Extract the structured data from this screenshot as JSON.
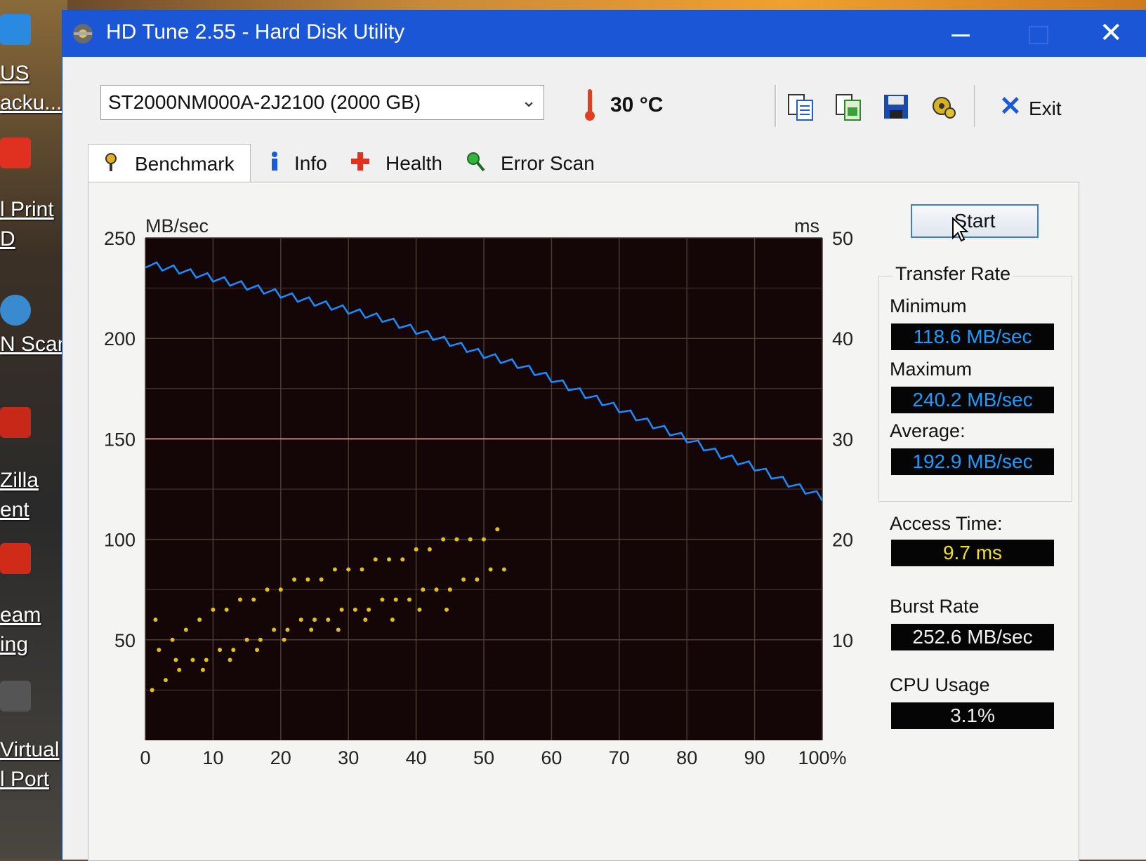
{
  "desktop": {
    "labels": [
      "US",
      "acku...",
      "l Print",
      "D",
      "N Scan",
      "Zilla",
      "ent",
      "eam",
      "ing",
      "Virtual",
      "l Port"
    ]
  },
  "window": {
    "title": "HD Tune 2.55 - Hard Disk Utility",
    "minimize_glyph": "—",
    "close_glyph": "✕"
  },
  "toolbar": {
    "drive": "ST2000NM000A-2J2100 (2000 GB)",
    "dropdown_glyph": "⌄",
    "temperature": "30 °C",
    "buttons": [
      "copy-text-icon",
      "copy-image-icon",
      "save-icon",
      "options-icon"
    ],
    "exit_label": "Exit"
  },
  "tabs": [
    {
      "label": "Benchmark",
      "icon": "benchmark-icon",
      "active": true
    },
    {
      "label": "Info",
      "icon": "info-icon",
      "active": false
    },
    {
      "label": "Health",
      "icon": "health-icon",
      "active": false
    },
    {
      "label": "Error Scan",
      "icon": "error-scan-icon",
      "active": false
    }
  ],
  "side_panel": {
    "start_label": "Start",
    "transfer_rate_title": "Transfer Rate",
    "minimum_label": "Minimum",
    "minimum_value": "118.6 MB/sec",
    "maximum_label": "Maximum",
    "maximum_value": "240.2 MB/sec",
    "average_label": "Average:",
    "average_value": "192.9 MB/sec",
    "access_time_label": "Access Time:",
    "access_time_value": "9.7 ms",
    "burst_rate_label": "Burst Rate",
    "burst_rate_value": "252.6 MB/sec",
    "cpu_usage_label": "CPU Usage",
    "cpu_usage_value": "3.1%"
  },
  "chart_data": {
    "type": "line",
    "title": "",
    "xlabel": "",
    "ylabel": "MB/sec",
    "y2label": "ms",
    "x_ticks": [
      "0",
      "10",
      "20",
      "30",
      "40",
      "50",
      "60",
      "70",
      "80",
      "90",
      "100%"
    ],
    "y_ticks": [
      "250",
      "200",
      "150",
      "100",
      "50"
    ],
    "y2_ticks": [
      "50",
      "40",
      "30",
      "20",
      "10"
    ],
    "xlim": [
      0,
      100
    ],
    "ylim": [
      0,
      250
    ],
    "y2lim": [
      0,
      50
    ],
    "grid": true,
    "colors": {
      "transfer": "#1a8cff",
      "access": "#e0c020",
      "background": "#140606",
      "grid": "#4a3a36",
      "midline": "#c08080"
    },
    "series": [
      {
        "axis": "left",
        "x": [
          0,
          5,
          10,
          15,
          20,
          25,
          30,
          35,
          40,
          45,
          50,
          55,
          60,
          65,
          70,
          75,
          80,
          85,
          90,
          95,
          100
        ],
        "values": [
          237,
          234,
          230,
          226,
          222,
          218,
          214,
          210,
          204,
          198,
          192,
          187,
          180,
          172,
          165,
          157,
          150,
          142,
          136,
          128,
          121
        ]
      },
      {
        "type": "scatter",
        "axis": "right",
        "x": [
          1,
          3,
          5,
          7,
          9,
          11,
          13,
          15,
          17,
          19,
          21,
          23,
          25,
          27,
          29,
          31,
          33,
          35,
          37,
          39,
          41,
          43,
          45,
          47,
          49,
          51,
          53,
          2,
          4,
          6,
          8,
          10,
          12,
          14,
          16,
          18,
          20,
          22,
          24,
          26,
          28,
          30,
          32,
          34,
          36,
          38,
          40,
          42,
          44,
          46,
          48,
          50,
          52,
          1.5,
          4.5,
          8.5,
          12.5,
          16.5,
          20.5,
          24.5,
          28.5,
          32.5,
          36.5,
          40.5,
          44.5
        ],
        "values": [
          5,
          6,
          7,
          8,
          8,
          9,
          9,
          10,
          10,
          11,
          11,
          12,
          12,
          12,
          13,
          13,
          13,
          14,
          14,
          14,
          15,
          15,
          15,
          16,
          16,
          17,
          17,
          9,
          10,
          11,
          12,
          13,
          13,
          14,
          14,
          15,
          15,
          16,
          16,
          16,
          17,
          17,
          17,
          18,
          18,
          18,
          19,
          19,
          20,
          20,
          20,
          20,
          21,
          12,
          8,
          7,
          8,
          9,
          10,
          11,
          11,
          12,
          12,
          13,
          13
        ]
      }
    ]
  }
}
